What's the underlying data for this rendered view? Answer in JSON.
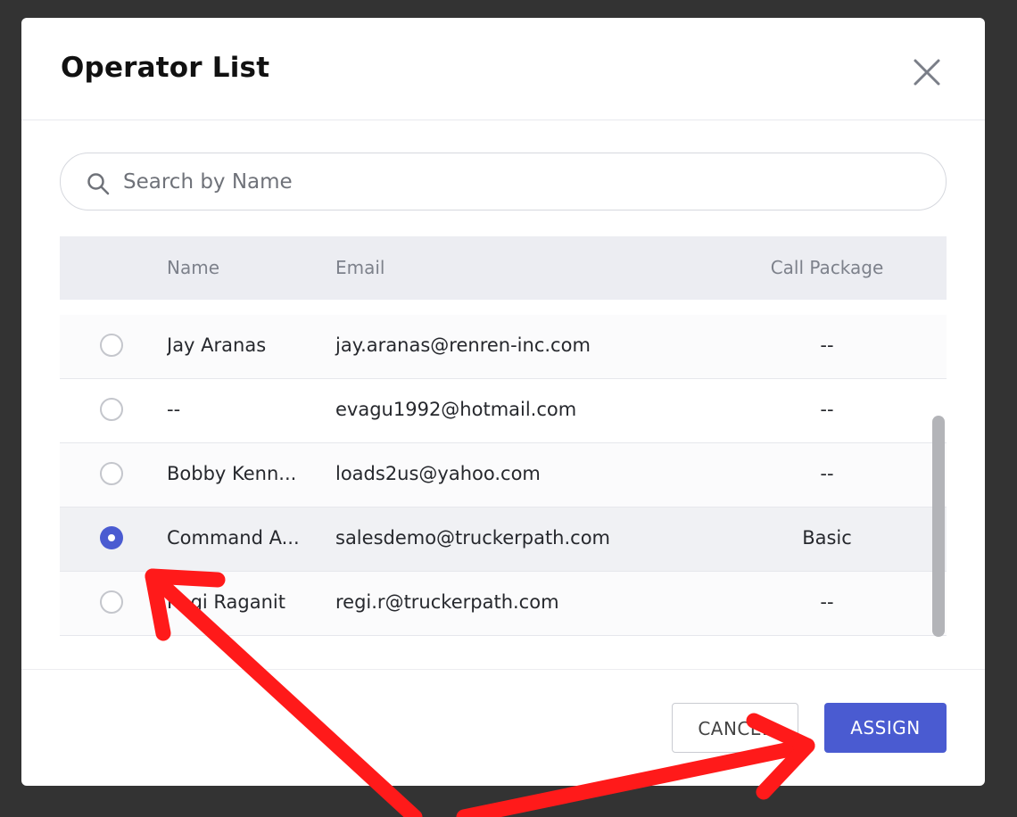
{
  "dialog": {
    "title": "Operator List",
    "close_icon": "close-icon"
  },
  "search": {
    "placeholder": "Search by Name",
    "value": "",
    "icon": "search-icon"
  },
  "table": {
    "headers": {
      "name": "Name",
      "email": "Email",
      "call_package": "Call Package"
    },
    "rows": [
      {
        "name": "Jay Aranas",
        "email": "jay.aranas@renren-inc.com",
        "call_package": "--",
        "selected": false
      },
      {
        "name": "--",
        "email": "evagu1992@hotmail.com",
        "call_package": "--",
        "selected": false
      },
      {
        "name": "Bobby Kenn...",
        "email": "loads2us@yahoo.com",
        "call_package": "--",
        "selected": false
      },
      {
        "name": "Command A...",
        "email": "salesdemo@truckerpath.com",
        "call_package": "Basic",
        "selected": true
      },
      {
        "name": "Regi Raganit",
        "email": "regi.r@truckerpath.com",
        "call_package": "--",
        "selected": false
      }
    ]
  },
  "footer": {
    "cancel_label": "CANCEL",
    "assign_label": "ASSIGN"
  },
  "colors": {
    "accent": "#4a5bd1",
    "annotation_arrows": "#ff1a1a",
    "backdrop": "#333333"
  }
}
